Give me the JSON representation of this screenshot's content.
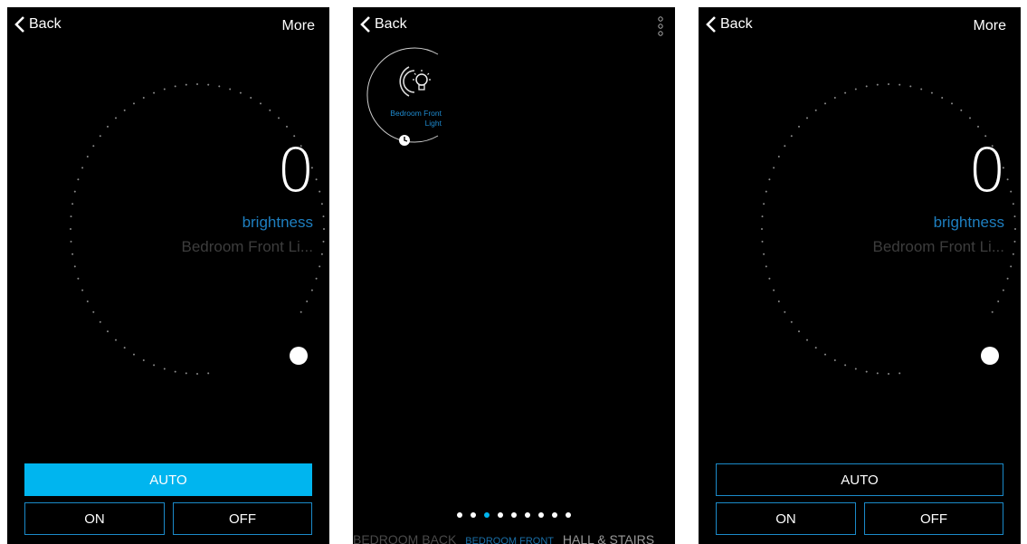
{
  "colors": {
    "accent": "#00b5ef",
    "accent_border": "#1b8ac9",
    "label_blue": "#1e7fc0",
    "dim_text": "#3d3d3d",
    "background": "#000000"
  },
  "left": {
    "nav": {
      "back_label": "Back",
      "more_label": "More"
    },
    "level": {
      "value": "0",
      "label": "brightness",
      "device": "Bedroom Front Li..."
    },
    "slider_level": 0,
    "buttons": {
      "auto": "AUTO",
      "on": "ON",
      "off": "OFF"
    },
    "auto_selected": true
  },
  "middle": {
    "nav": {
      "back_label": "Back"
    },
    "device": {
      "name_line1": "Bedroom Front",
      "name_line2": "Light",
      "icon": "lightbulb-icon",
      "timer_icon": "clock-icon"
    },
    "pager": {
      "total": 9,
      "active_index": 2
    },
    "rooms": [
      "BEDROOM BACK",
      "BEDROOM FRONT",
      "HALL & STAIRS"
    ]
  },
  "right": {
    "nav": {
      "back_label": "Back",
      "more_label": "More"
    },
    "level": {
      "value": "0",
      "label": "brightness",
      "device": "Bedroom Front Li..."
    },
    "slider_level": 0,
    "buttons": {
      "auto": "AUTO",
      "on": "ON",
      "off": "OFF"
    },
    "auto_selected": false
  }
}
